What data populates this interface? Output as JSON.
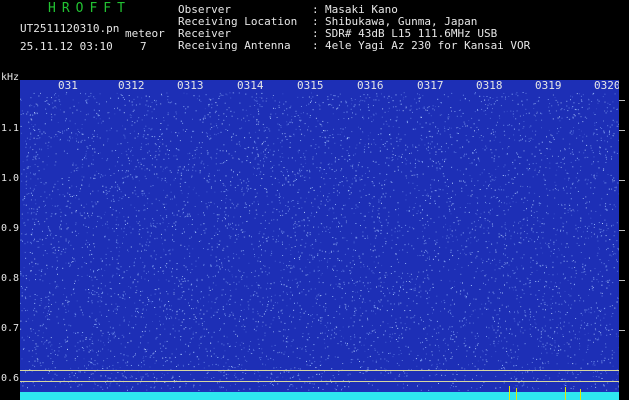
{
  "header": {
    "brand": "HROFFT",
    "filename": "UT2511120310.pn",
    "filename_tag": "meteor",
    "datetime": "25.11.12 03:10",
    "count": "7",
    "info": [
      {
        "key": "Observer",
        "sep": ":",
        "value": "Masaki Kano"
      },
      {
        "key": "Receiving Location",
        "sep": ":",
        "value": "Shibukawa, Gunma, Japan"
      },
      {
        "key": "Receiver",
        "sep": ":",
        "value": "SDR# 43dB L15 111.6MHz USB"
      },
      {
        "key": "Receiving Antenna",
        "sep": ":",
        "value": "4ele Yagi Az 230 for Kansai VOR"
      }
    ]
  },
  "spectrogram": {
    "y_unit": "kHz",
    "y_ticks": [
      "1.1",
      "1.0",
      "0.9",
      "0.8",
      "0.7",
      "0.6"
    ],
    "x_labels": [
      "031",
      "0312",
      "0313",
      "0314",
      "0315",
      "0316",
      "0317",
      "0318",
      "0319",
      "0320"
    ],
    "colors": {
      "background": "#1d2fb6",
      "noise": "#8fb3ff",
      "baseline": "#2ee6f0",
      "guide": "#d6d6a0",
      "spike": "#e6e600"
    }
  }
}
